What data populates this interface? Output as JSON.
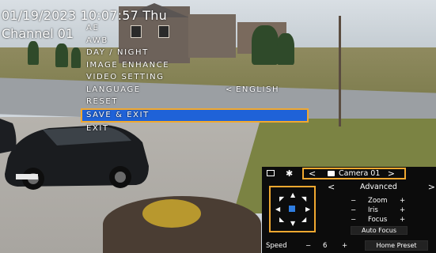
{
  "osd": {
    "datetime": "01/19/2023 10:07:57 Thu",
    "channel": "Channel 01"
  },
  "menu": {
    "items": [
      {
        "label": "AE",
        "arrow": "",
        "value": ""
      },
      {
        "label": "AWB",
        "arrow": "",
        "value": ""
      },
      {
        "label": "DAY / NIGHT",
        "arrow": "",
        "value": ""
      },
      {
        "label": "IMAGE ENHANCE",
        "arrow": "",
        "value": ""
      },
      {
        "label": "VIDEO SETTING",
        "arrow": "",
        "value": ""
      },
      {
        "label": "LANGUAGE",
        "arrow": "<",
        "value": "ENGLISH"
      },
      {
        "label": "RESET",
        "arrow": "",
        "value": ""
      },
      {
        "label": "SAVE & EXIT",
        "arrow": "",
        "value": ""
      },
      {
        "label": "EXIT",
        "arrow": "",
        "value": ""
      }
    ],
    "selected_index": 7
  },
  "ptz": {
    "camera_prev": "<",
    "camera_label": "Camera 01",
    "camera_next": ">",
    "advanced_prev": "<",
    "advanced_label": "Advanced",
    "advanced_next": ">",
    "controls": [
      {
        "minus": "−",
        "label": "Zoom",
        "plus": "+"
      },
      {
        "minus": "−",
        "label": "Iris",
        "plus": "+"
      },
      {
        "minus": "−",
        "label": "Focus",
        "plus": "+"
      }
    ],
    "auto_focus": "Auto Focus",
    "speed_label": "Speed",
    "speed_minus": "−",
    "speed_value": "6",
    "speed_plus": "+",
    "home_preset": "Home Preset",
    "dpad": {
      "up": "▲",
      "down": "▼",
      "left": "◀",
      "right": "▶",
      "up_left": "◤",
      "up_right": "◥",
      "down_left": "◣",
      "down_right": "◢"
    }
  },
  "colors": {
    "highlight": "#f0a830",
    "selection": "#1f62d8",
    "center_dot": "#2f7de1",
    "panel_bg": "#0c0c0c"
  }
}
